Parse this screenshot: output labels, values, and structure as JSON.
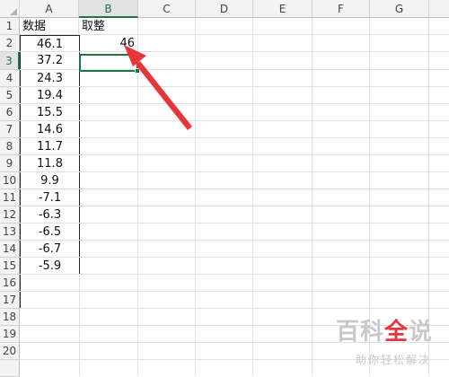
{
  "columns": [
    "A",
    "B",
    "C",
    "D",
    "E",
    "F",
    "G"
  ],
  "active_column": "B",
  "rows": [
    "1",
    "2",
    "3",
    "4",
    "5",
    "6",
    "7",
    "8",
    "9",
    "10",
    "11",
    "12",
    "13",
    "14",
    "15",
    "16",
    "17",
    "18",
    "19",
    "20"
  ],
  "active_row": "3",
  "header_row": {
    "a1": "数据",
    "b1": "取整"
  },
  "column_a_values": [
    "46.1",
    "37.2",
    "24.3",
    "19.4",
    "15.5",
    "14.6",
    "11.7",
    "11.8",
    "9.9",
    "-7.1",
    "-6.3",
    "-6.5",
    "-6.7",
    "-5.9"
  ],
  "b2_value": "46",
  "colors": {
    "accent_green": "#217346",
    "arrow_red": "#e8353b"
  },
  "watermark": {
    "title_pre": "百科",
    "title_accent": "全",
    "title_post": "说",
    "subtitle": "助你轻松解决"
  }
}
